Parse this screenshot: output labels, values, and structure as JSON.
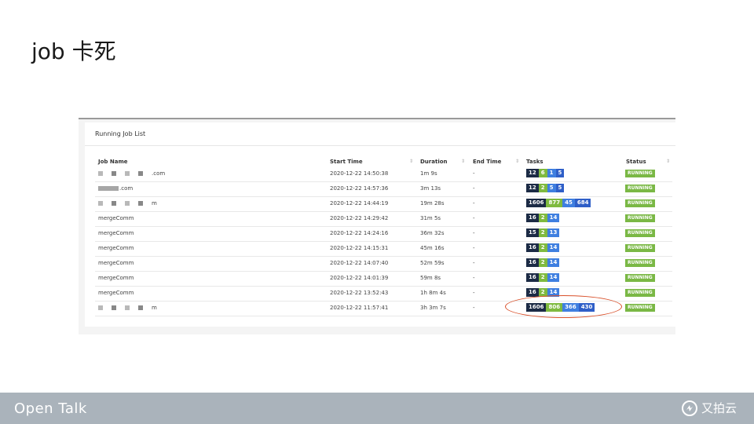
{
  "slide": {
    "title": "job 卡死"
  },
  "panel": {
    "title": "Running Job List",
    "columns": [
      "Job Name",
      "Start Time",
      "Duration",
      "End Time",
      "Tasks",
      "Status"
    ]
  },
  "rows": [
    {
      "name": ".com",
      "start": "2020-12-22 14:50:38",
      "duration": "1m 9s",
      "end": "-",
      "tasks": [
        "12",
        "6",
        "1",
        "5"
      ],
      "status": "RUNNING"
    },
    {
      "name": ".com",
      "start": "2020-12-22 14:57:36",
      "duration": "3m 13s",
      "end": "-",
      "tasks": [
        "12",
        "2",
        "5",
        "5"
      ],
      "status": "RUNNING"
    },
    {
      "name": "m",
      "start": "2020-12-22 14:44:19",
      "duration": "19m 28s",
      "end": "-",
      "tasks": [
        "1606",
        "877",
        "45",
        "684"
      ],
      "status": "RUNNING"
    },
    {
      "name": "mergeComm",
      "start": "2020-12-22 14:29:42",
      "duration": "31m 5s",
      "end": "-",
      "tasks": [
        "16",
        "2",
        "14"
      ],
      "status": "RUNNING"
    },
    {
      "name": "mergeComm",
      "start": "2020-12-22 14:24:16",
      "duration": "36m 32s",
      "end": "-",
      "tasks": [
        "15",
        "2",
        "13"
      ],
      "status": "RUNNING"
    },
    {
      "name": "mergeComm",
      "start": "2020-12-22 14:15:31",
      "duration": "45m 16s",
      "end": "-",
      "tasks": [
        "16",
        "2",
        "14"
      ],
      "status": "RUNNING"
    },
    {
      "name": "mergeComm",
      "start": "2020-12-22 14:07:40",
      "duration": "52m 59s",
      "end": "-",
      "tasks": [
        "16",
        "2",
        "14"
      ],
      "status": "RUNNING"
    },
    {
      "name": "mergeComm",
      "start": "2020-12-22 14:01:39",
      "duration": "59m 8s",
      "end": "-",
      "tasks": [
        "16",
        "2",
        "14"
      ],
      "status": "RUNNING"
    },
    {
      "name": "mergeComm",
      "start": "2020-12-22 13:52:43",
      "duration": "1h 8m 4s",
      "end": "-",
      "tasks": [
        "16",
        "2",
        "14"
      ],
      "status": "RUNNING"
    },
    {
      "name": "m",
      "start": "2020-12-22 11:57:41",
      "duration": "3h 3m 7s",
      "end": "-",
      "tasks": [
        "1606",
        "806",
        "366",
        "430"
      ],
      "status": "RUNNING"
    }
  ],
  "colors": {
    "task_total": "#1c2b45",
    "task_running": "#7fba3f",
    "task_blue": "#3f7fe0",
    "status": "#7ab845",
    "highlight_circle": "#d9502a"
  },
  "footer": {
    "left_brand": "Open Talk",
    "right_brand": "又拍云",
    "right_icon": "upyun-logo-icon"
  }
}
